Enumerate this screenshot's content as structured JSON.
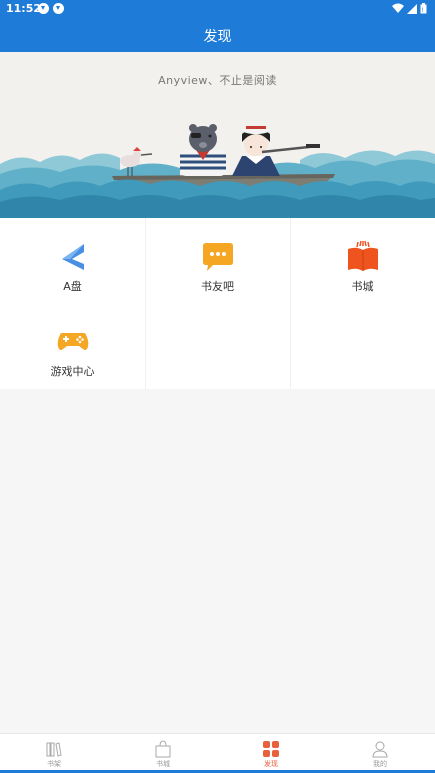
{
  "status_bar": {
    "time": "11:52"
  },
  "app_bar": {
    "title": "发现"
  },
  "banner": {
    "slogan": "Anyview、不止是阅读"
  },
  "grid": {
    "items": [
      {
        "label": "A盘",
        "icon": "a-drive-icon"
      },
      {
        "label": "书友吧",
        "icon": "chat-bubble-icon"
      },
      {
        "label": "书城",
        "icon": "open-book-icon"
      },
      {
        "label": "游戏中心",
        "icon": "gamepad-icon"
      }
    ]
  },
  "tabbar": {
    "active_color": "#e8613d",
    "tabs": [
      {
        "label": "书架",
        "icon": "bookshelf-icon"
      },
      {
        "label": "书城",
        "icon": "shopping-bag-icon"
      },
      {
        "label": "发现",
        "icon": "discover-grid-icon",
        "active": true
      },
      {
        "label": "我的",
        "icon": "person-icon"
      }
    ]
  },
  "colors": {
    "primary": "#1e7bd8",
    "accent": "#e8613d"
  }
}
